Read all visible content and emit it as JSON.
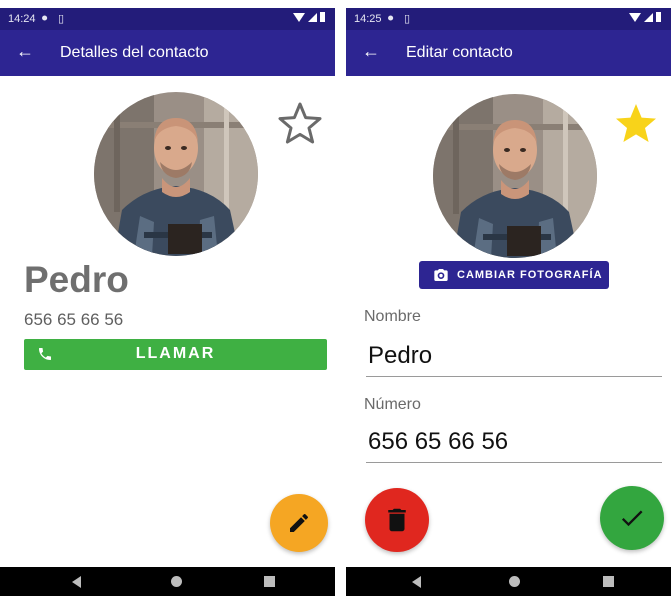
{
  "colors": {
    "status_bar": "#231c7a",
    "app_bar": "#2d2592",
    "call_button": "#3fb043",
    "edit_fab": "#f5a623",
    "delete_fab": "#e0271f",
    "save_fab": "#33a63f",
    "star_filled": "#f8d31a",
    "star_outline": "#6a6a6a",
    "nav_bar": "#000000"
  },
  "details_screen": {
    "status_time": "14:24",
    "title": "Detalles del contacto",
    "back_icon": "arrow-back-icon",
    "favorite_icon": "star-outline-icon",
    "contact_name": "Pedro",
    "phone": "656 65 66 56",
    "call_button": {
      "label": "LLAMAR",
      "icon": "phone-icon"
    },
    "edit_fab_icon": "pencil-icon"
  },
  "edit_screen": {
    "status_time": "14:25",
    "title": "Editar contacto",
    "back_icon": "arrow-back-icon",
    "favorite_icon": "star-filled-icon",
    "change_photo_button": {
      "label": "CAMBIAR FOTOGRAFÍA",
      "icon": "camera-icon"
    },
    "fields": {
      "name": {
        "label": "Nombre",
        "value": "Pedro"
      },
      "number": {
        "label": "Número",
        "value": "656 65 66 56"
      }
    },
    "delete_fab_icon": "trash-icon",
    "save_fab_icon": "check-icon"
  }
}
